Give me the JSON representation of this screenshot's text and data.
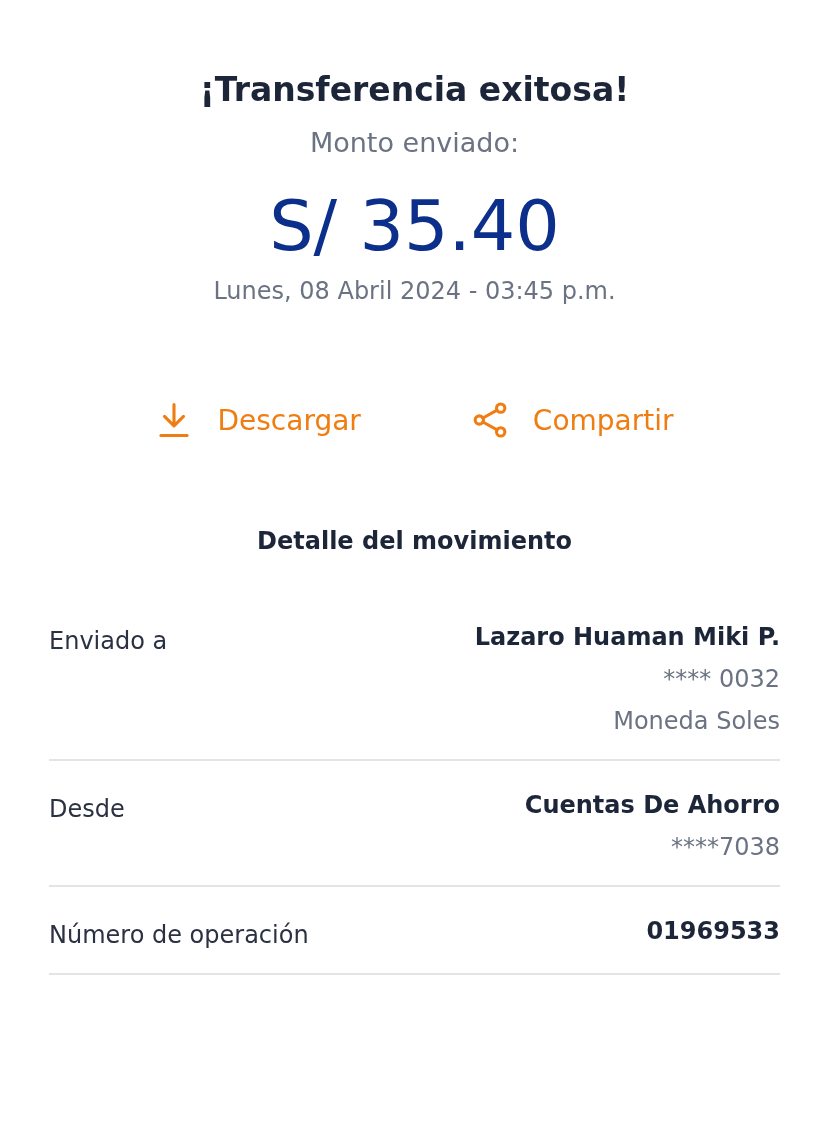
{
  "title": "¡Transferencia exitosa!",
  "amount_label": "Monto enviado:",
  "amount": "S/ 35.40",
  "datetime": "Lunes, 08 Abril 2024 - 03:45 p.m.",
  "actions": [
    {
      "kind": "download",
      "label": "Descargar"
    },
    {
      "kind": "share",
      "label": "Compartir"
    }
  ],
  "details": {
    "heading": "Detalle del movimiento",
    "rows": [
      {
        "label": "Enviado a",
        "values": [
          "Lazaro Huaman Miki P.",
          "**** 0032",
          "Moneda Soles"
        ]
      },
      {
        "label": "Desde",
        "values": [
          "Cuentas De Ahorro",
          "****7038"
        ]
      },
      {
        "label": "Número de operación",
        "values": [
          "01969533"
        ]
      }
    ]
  }
}
